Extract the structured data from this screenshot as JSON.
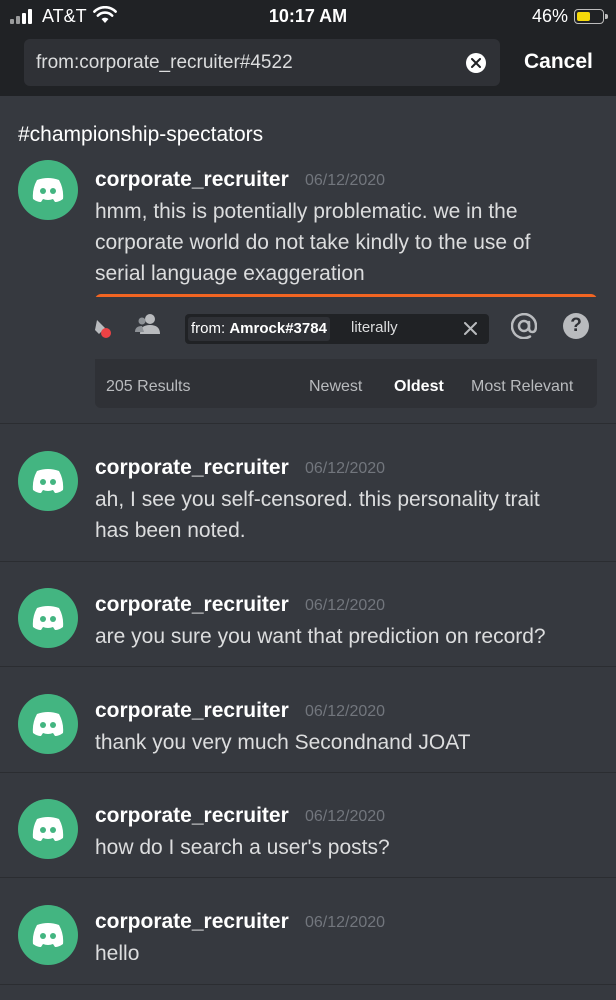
{
  "status_bar": {
    "carrier": "AT&T",
    "time": "10:17 AM",
    "battery": "46%"
  },
  "search": {
    "query": "from:corporate_recruiter#4522",
    "cancel_label": "Cancel"
  },
  "channel": "#championship-spectators",
  "embed": {
    "chip_prefix": "from:",
    "chip_user": "Amrock#3784",
    "term": "literally",
    "results": "205 Results",
    "sort": [
      "Newest",
      "Oldest",
      "Most Relevant"
    ],
    "active_sort": "Oldest"
  },
  "messages": [
    {
      "author": "corporate_recruiter",
      "date": "06/12/2020",
      "lines": [
        "hmm, this is potentially problematic. we in the",
        "corporate world do not take kindly to the use of",
        "serial language exaggeration"
      ]
    },
    {
      "author": "corporate_recruiter",
      "date": "06/12/2020",
      "lines": [
        "ah, I see you self-censored. this personality trait",
        "has been noted."
      ]
    },
    {
      "author": "corporate_recruiter",
      "date": "06/12/2020",
      "lines": [
        "are you sure you want that prediction on record?"
      ]
    },
    {
      "author": "corporate_recruiter",
      "date": "06/12/2020",
      "lines": [
        "thank you very much Secondnand JOAT"
      ]
    },
    {
      "author": "corporate_recruiter",
      "date": "06/12/2020",
      "lines": [
        "how do I search a user's posts?"
      ]
    },
    {
      "author": "corporate_recruiter",
      "date": "06/12/2020",
      "lines": [
        "hello"
      ]
    }
  ],
  "colors": {
    "background": "#36393f",
    "header": "#202225",
    "avatar": "#43b581",
    "embed_accent": "#f26522"
  }
}
